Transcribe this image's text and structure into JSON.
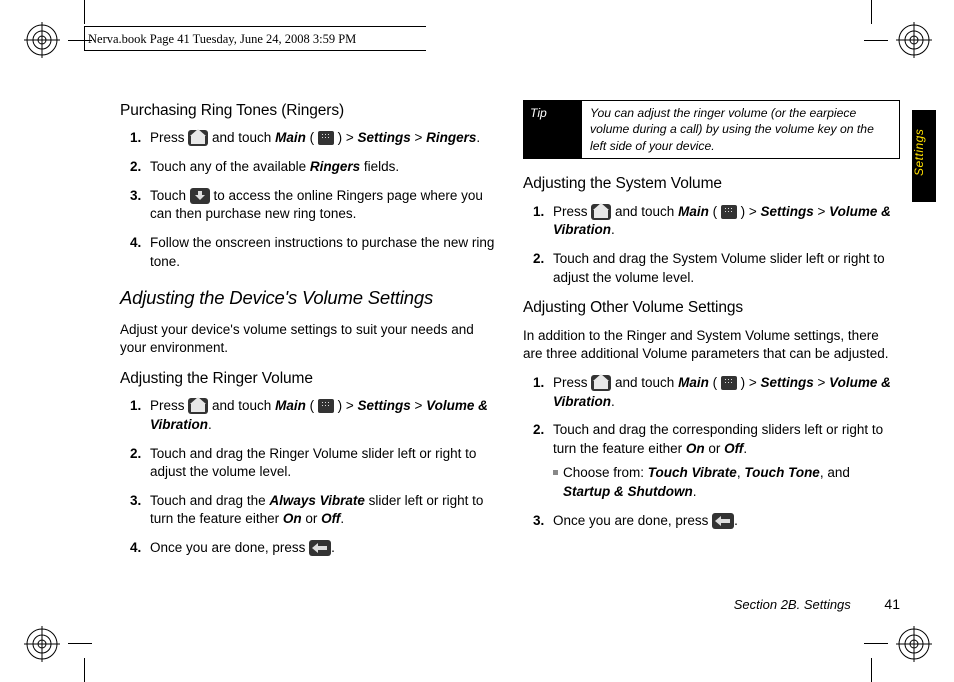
{
  "meta": {
    "header": "Nerva.book  Page 41  Tuesday, June 24, 2008  3:59 PM"
  },
  "sidetab": "Settings",
  "footer": {
    "section": "Section 2B. Settings",
    "page": "41"
  },
  "left": {
    "h_purchase": "Purchasing Ring Tones (Ringers)",
    "purchase_steps": {
      "s1a": "Press ",
      "s1b": " and touch ",
      "s1_main": "Main",
      "s1c": " ( ",
      "s1d": " ) > ",
      "s1_settings": "Settings",
      "s1e": " > ",
      "s1_ringers": "Ringers",
      "s1f": ".",
      "s2a": "Touch any of the available ",
      "s2_ringers": "Ringers",
      "s2b": " fields.",
      "s3a": "Touch ",
      "s3b": " to access the online Ringers page where you can then purchase new ring tones.",
      "s4": "Follow the onscreen instructions to purchase the new ring tone."
    },
    "h_adjust_device": "Adjusting the Device's Volume Settings",
    "adjust_intro": "Adjust your device's volume settings to suit your needs and your environment.",
    "h_ringer": "Adjusting the Ringer Volume",
    "ringer_steps": {
      "s1a": "Press ",
      "s1b": " and touch ",
      "s1_main": "Main",
      "s1c": " ( ",
      "s1d": " ) > ",
      "s1_settings": "Settings",
      "s1e": " > ",
      "s1_vv": "Volume & Vibration",
      "s1f": ".",
      "s2": "Touch and drag the Ringer Volume slider left or right to adjust the volume level.",
      "s3a": "Touch and drag the ",
      "s3_av": "Always Vibrate",
      "s3b": " slider left or right to turn the feature either ",
      "s3_on": "On",
      "s3c": " or ",
      "s3_off": "Off",
      "s3d": ".",
      "s4a": "Once you are done, press ",
      "s4b": "."
    }
  },
  "right": {
    "tip_label": "Tip",
    "tip_text": "You can adjust the ringer volume (or the earpiece volume during a call) by using the volume key on the left side of your device.",
    "h_system": "Adjusting the System Volume",
    "system_steps": {
      "s1a": "Press ",
      "s1b": " and touch ",
      "s1_main": "Main",
      "s1c": " ( ",
      "s1d": " ) > ",
      "s1_settings": "Settings",
      "s1e": " > ",
      "s1_vv": "Volume & Vibration",
      "s1f": ".",
      "s2": "Touch and drag the System Volume slider left or right to adjust the volume level."
    },
    "h_other": "Adjusting Other Volume Settings",
    "other_intro": "In addition to the Ringer and System Volume settings, there are three additional Volume parameters that can be adjusted.",
    "other_steps": {
      "s1a": "Press ",
      "s1b": " and touch ",
      "s1_main": "Main",
      "s1c": " ( ",
      "s1d": " ) > ",
      "s1_settings": "Settings",
      "s1e": " > ",
      "s1_vv": "Volume & Vibration",
      "s1f": ".",
      "s2a": "Touch and drag the corresponding sliders left or right to turn the feature either ",
      "s2_on": "On",
      "s2b": " or ",
      "s2_off": "Off",
      "s2c": ".",
      "sub_a": "Choose from: ",
      "sub_tv": "Touch Vibrate",
      "sub_b": ", ",
      "sub_tt": "Touch Tone",
      "sub_c": ", and ",
      "sub_ss": "Startup & Shutdown",
      "sub_d": ".",
      "s3a": "Once you are done, press ",
      "s3b": "."
    }
  }
}
